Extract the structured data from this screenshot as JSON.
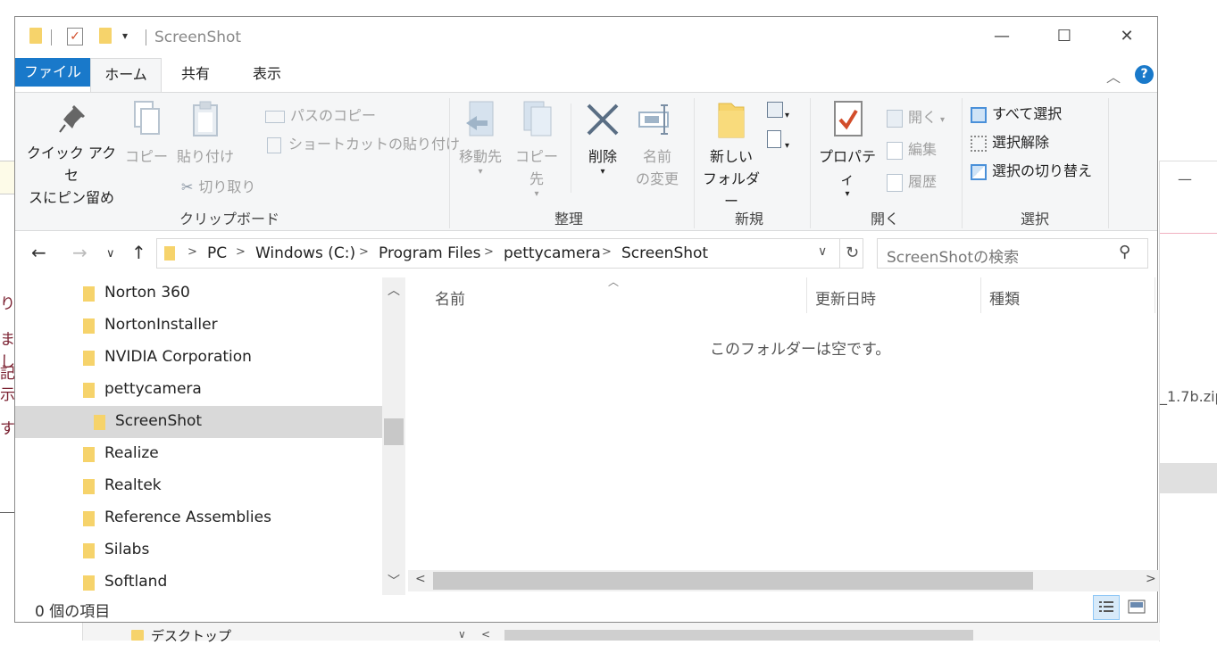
{
  "window": {
    "title": "ScreenShot",
    "minimize": "—",
    "maximize": "☐",
    "close": "✕"
  },
  "ribbon_tabs": {
    "file": "ファイル",
    "home": "ホーム",
    "share": "共有",
    "view": "表示"
  },
  "ribbon": {
    "clipboard": {
      "pin_line1": "クイック アクセ",
      "pin_line2": "スにピン留め",
      "copy": "コピー",
      "paste": "貼り付け",
      "copy_path": "パスのコピー",
      "paste_shortcut": "ショートカットの貼り付け",
      "cut": "切り取り",
      "group_label": "クリップボード"
    },
    "organize": {
      "move_to": "移動先",
      "copy_to": "コピー先",
      "delete": "削除",
      "rename_line1": "名前",
      "rename_line2": "の変更",
      "group_label": "整理"
    },
    "new": {
      "new_folder_line1": "新しい",
      "new_folder_line2": "フォルダー",
      "group_label": "新規"
    },
    "open": {
      "properties": "プロパティ",
      "open": "開く",
      "edit": "編集",
      "history": "履歴",
      "group_label": "開く"
    },
    "select": {
      "select_all": "すべて選択",
      "select_none": "選択解除",
      "invert": "選択の切り替え",
      "group_label": "選択"
    }
  },
  "address": {
    "crumbs": [
      "PC",
      "Windows (C:)",
      "Program Files",
      "pettycamera",
      "ScreenShot"
    ],
    "search_placeholder": "ScreenShotの検索"
  },
  "nav_tree": [
    {
      "label": "Norton 360"
    },
    {
      "label": "NortonInstaller"
    },
    {
      "label": "NVIDIA Corporation"
    },
    {
      "label": "pettycamera"
    },
    {
      "label": "ScreenShot",
      "selected": true
    },
    {
      "label": "Realize"
    },
    {
      "label": "Realtek"
    },
    {
      "label": "Reference Assemblies"
    },
    {
      "label": "Silabs"
    },
    {
      "label": "Softland"
    }
  ],
  "columns": {
    "name": "名前",
    "modified": "更新日時",
    "type": "種類"
  },
  "empty_message": "このフォルダーは空です。",
  "status": {
    "item_count": "0 個の項目"
  },
  "background": {
    "left_fragments": [
      "り",
      "まし",
      "記",
      "示",
      "す"
    ],
    "right_zip": "_1.7b.zip",
    "bottom_folder": "デスクトップ"
  }
}
